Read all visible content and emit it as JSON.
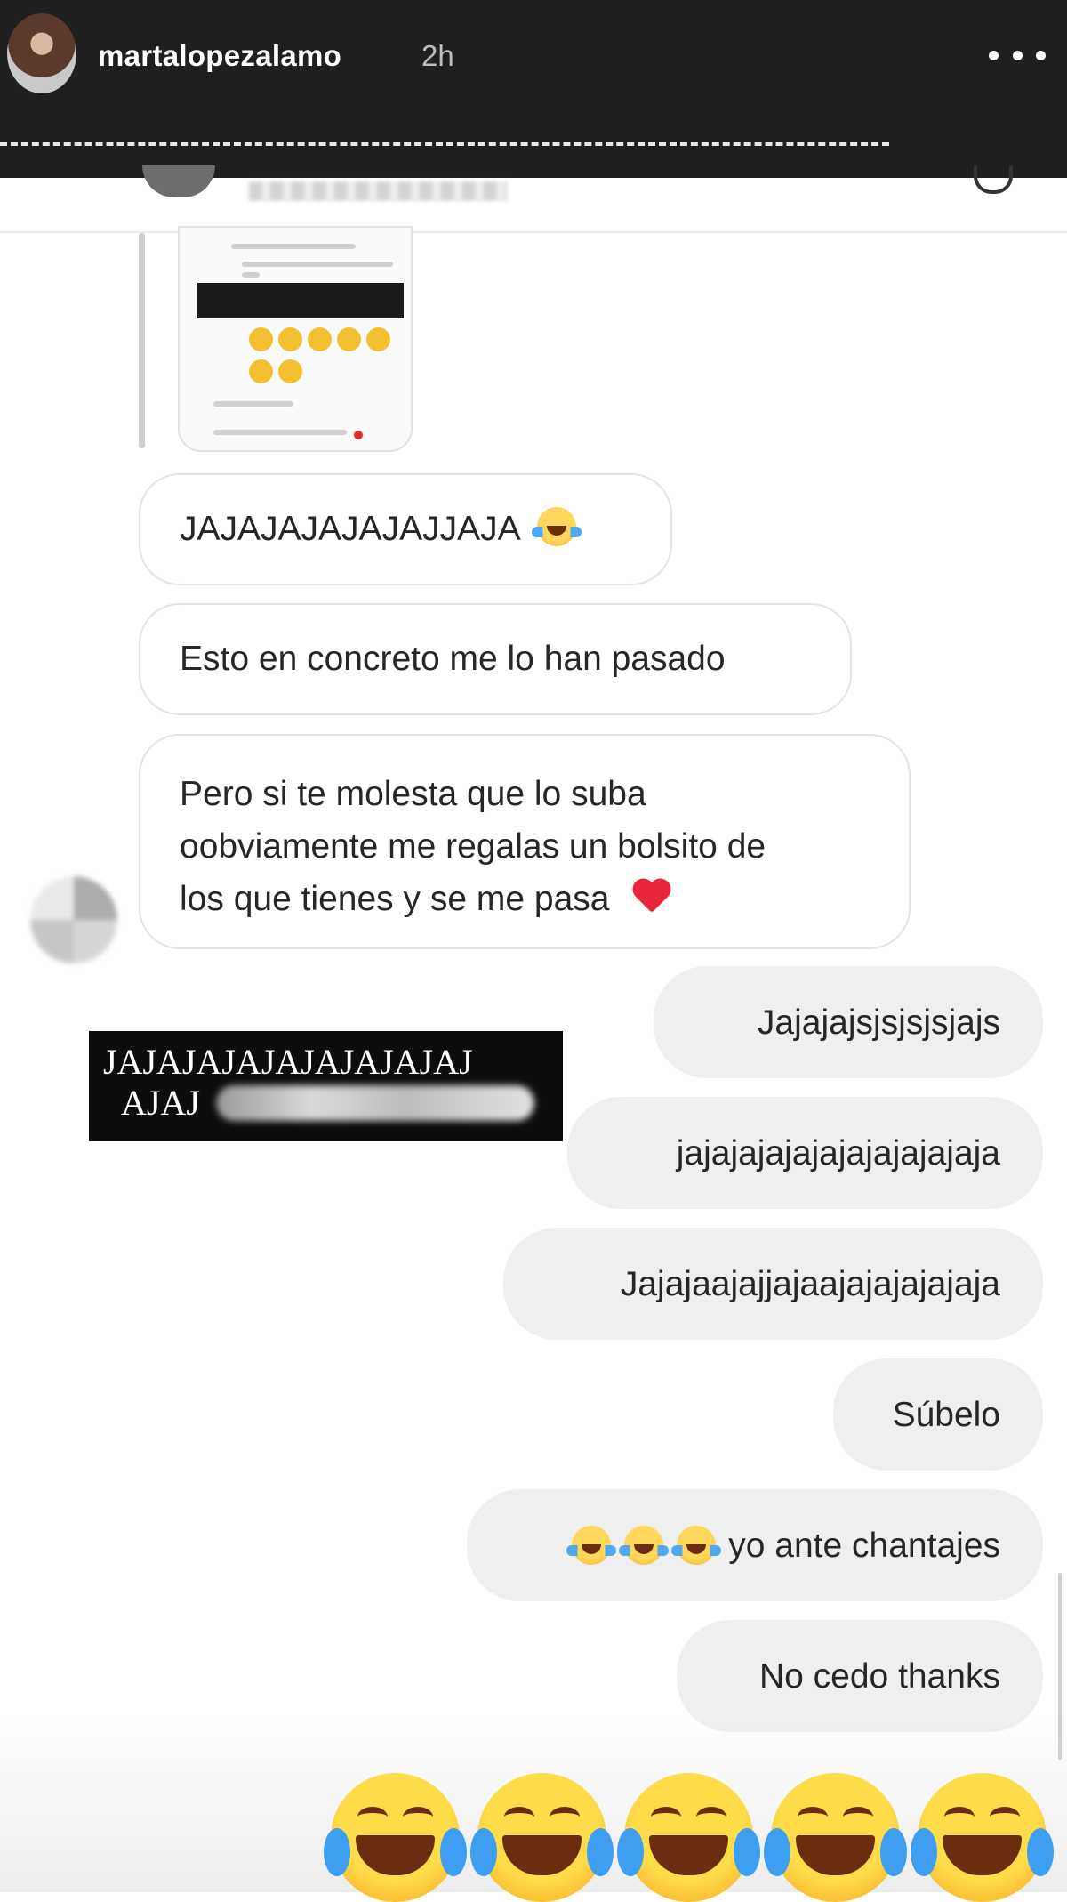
{
  "story_header": {
    "username": "martalopezalamo",
    "time": "2h",
    "more_icon": "ellipsis-horizontal-icon"
  },
  "thread": {
    "incoming": [
      {
        "text": "JAJAJAJAJAJAJJAJA",
        "emoji": "face-with-tears-of-joy"
      },
      {
        "text": "Esto en concreto me lo han pasado"
      },
      {
        "line1": "Pero si te molesta que lo suba",
        "line2": "oobviamente me regalas un bolsito de",
        "line3": "los que tienes y se me pasa",
        "emoji": "red-heart"
      }
    ],
    "outgoing": [
      {
        "text": "Jajajajsjsjsjsjajs"
      },
      {
        "text": "jajajajajajajajajajajaja"
      },
      {
        "text": "Jajajaajajjajaajajajajajaja"
      },
      {
        "text": "Súbelo"
      },
      {
        "text": "yo ante chantajes",
        "emoji": "face-with-tears-of-joy",
        "emoji_count": 3
      },
      {
        "text": "No cedo thanks"
      }
    ]
  },
  "sticker": {
    "line1": "JAJAJAJAJAJAJAJAJAJ",
    "line2": "AJAJ"
  },
  "bottom_sticker": {
    "emoji": "face-with-tears-of-joy",
    "count": 5
  }
}
